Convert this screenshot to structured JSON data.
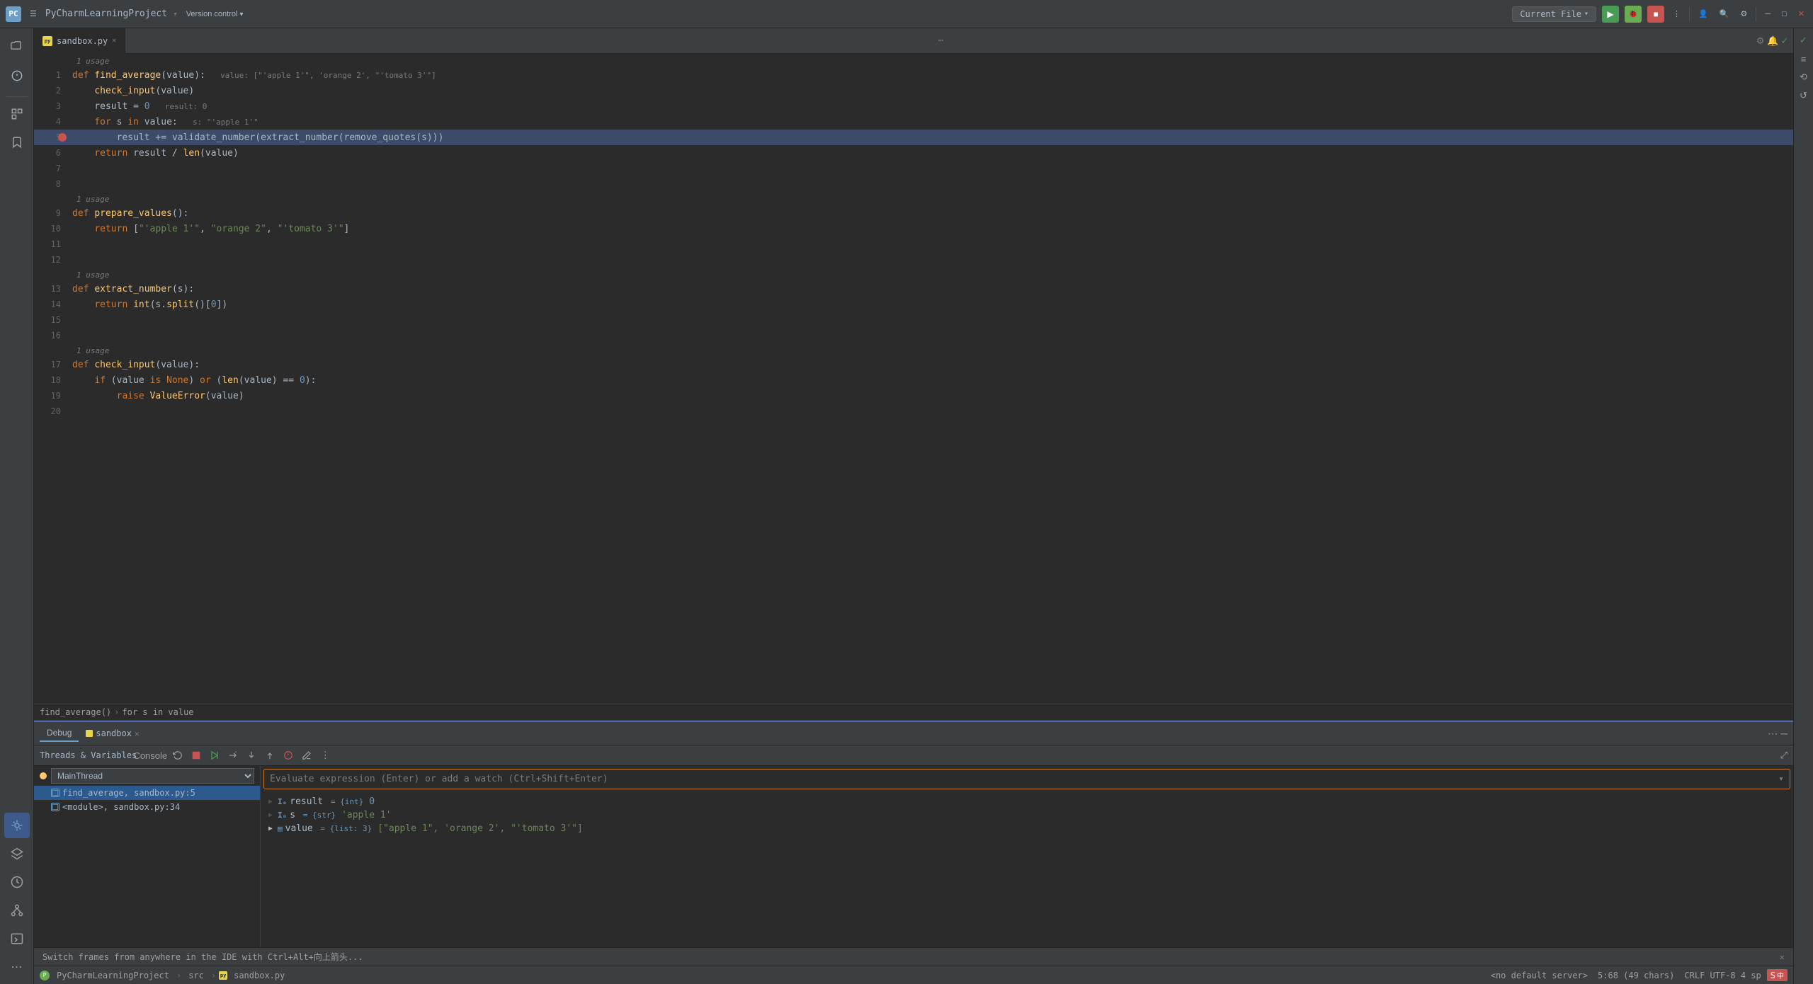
{
  "titleBar": {
    "projectName": "PyCharmLearningProject",
    "versionControl": "Version control",
    "chevron": "▾",
    "currentFile": "Current File",
    "currentFileChevron": "▾"
  },
  "tabs": {
    "items": [
      {
        "name": "sandbox.py",
        "active": true,
        "icon": "py"
      }
    ],
    "moreIcon": "⋯"
  },
  "code": {
    "usages": [
      {
        "line": "usage_1",
        "text": "1 usage",
        "before_line": 1
      },
      {
        "line": "usage_2",
        "text": "1 usage",
        "before_line": 9
      },
      {
        "line": "usage_3",
        "text": "1 usage",
        "before_line": 13
      },
      {
        "line": "usage_4",
        "text": "1 usage",
        "before_line": 17
      }
    ],
    "lines": [
      {
        "num": 1,
        "content": "def find_average(value):",
        "hint": "value: [\"'apple 1'\", 'orange 2', \"'tomato 3'\"]"
      },
      {
        "num": 2,
        "content": "    check_input(value)"
      },
      {
        "num": 3,
        "content": "    result = 0",
        "hint": "result: 0"
      },
      {
        "num": 4,
        "content": "    for s in value:",
        "hint": "s: \"'apple 1'\""
      },
      {
        "num": 5,
        "content": "        result += validate_number(extract_number(remove_quotes(s)))",
        "highlighted": true,
        "breakpoint": true
      },
      {
        "num": 6,
        "content": "    return result / len(value)"
      },
      {
        "num": 7,
        "content": ""
      },
      {
        "num": 8,
        "content": ""
      },
      {
        "num": 9,
        "content": "def prepare_values():"
      },
      {
        "num": 10,
        "content": "    return [\"'apple 1'\", \"orange 2\", \"'tomato 3'\"]"
      },
      {
        "num": 11,
        "content": ""
      },
      {
        "num": 12,
        "content": ""
      },
      {
        "num": 13,
        "content": "def extract_number(s):"
      },
      {
        "num": 14,
        "content": "    return int(s.split()[0])"
      },
      {
        "num": 15,
        "content": ""
      },
      {
        "num": 16,
        "content": ""
      },
      {
        "num": 17,
        "content": "def check_input(value):"
      },
      {
        "num": 18,
        "content": "    if (value is None) or (len(value) == 0):"
      },
      {
        "num": 19,
        "content": "        raise ValueError(value)"
      },
      {
        "num": 20,
        "content": ""
      }
    ]
  },
  "breadcrumb": {
    "items": [
      "find_average()",
      "for s in value"
    ]
  },
  "debug": {
    "tabDebug": "Debug",
    "tabSandbox": "sandbox",
    "toolbar": {
      "threadsVariables": "Threads & Variables",
      "console": "Console",
      "buttons": [
        "↺",
        "□",
        "▷▷",
        "▷",
        "↓",
        "↑",
        "⤴",
        "⊘",
        "✎",
        "⋮"
      ]
    },
    "threads": {
      "mainThread": "MainThread",
      "frames": [
        {
          "name": "find_average, sandbox.py:5",
          "selected": true
        },
        {
          "name": "<module>, sandbox.py:34"
        }
      ]
    },
    "variables": {
      "evalPlaceholder": "Evaluate expression (Enter) or add a watch (Ctrl+Shift+Enter)",
      "items": [
        {
          "name": "result",
          "type": "int",
          "value": "0",
          "expand": false
        },
        {
          "name": "s",
          "type": "str",
          "value": "\"apple 1\"",
          "expand": false
        },
        {
          "name": "value",
          "type": "list: 3",
          "value": "[\"apple 1\", 'orange 2', \"'tomato 3'\"]",
          "expand": true
        }
      ]
    }
  },
  "notification": {
    "text": "Switch frames from anywhere in the IDE with Ctrl+Alt+向上箭头...",
    "closeIcon": "✕"
  },
  "statusBar": {
    "project": "PyCharmLearningProject",
    "src": "src",
    "file": "sandbox.py",
    "server": "<no default server>",
    "position": "5:68 (49 chars)",
    "encoding": "CRLF  UTF-8  4 sp",
    "inputMethod": "中"
  },
  "activityBar": {
    "buttons": [
      {
        "icon": "📁",
        "name": "project",
        "label": ""
      },
      {
        "icon": "🔍",
        "name": "find"
      },
      {
        "icon": "🔧",
        "name": "tools"
      },
      {
        "icon": "📎",
        "name": "bookmark"
      },
      {
        "icon": "⋯",
        "name": "more"
      }
    ]
  },
  "rightToolbar": {
    "buttons": [
      "✓",
      "≡",
      "⟲",
      "↺"
    ]
  }
}
